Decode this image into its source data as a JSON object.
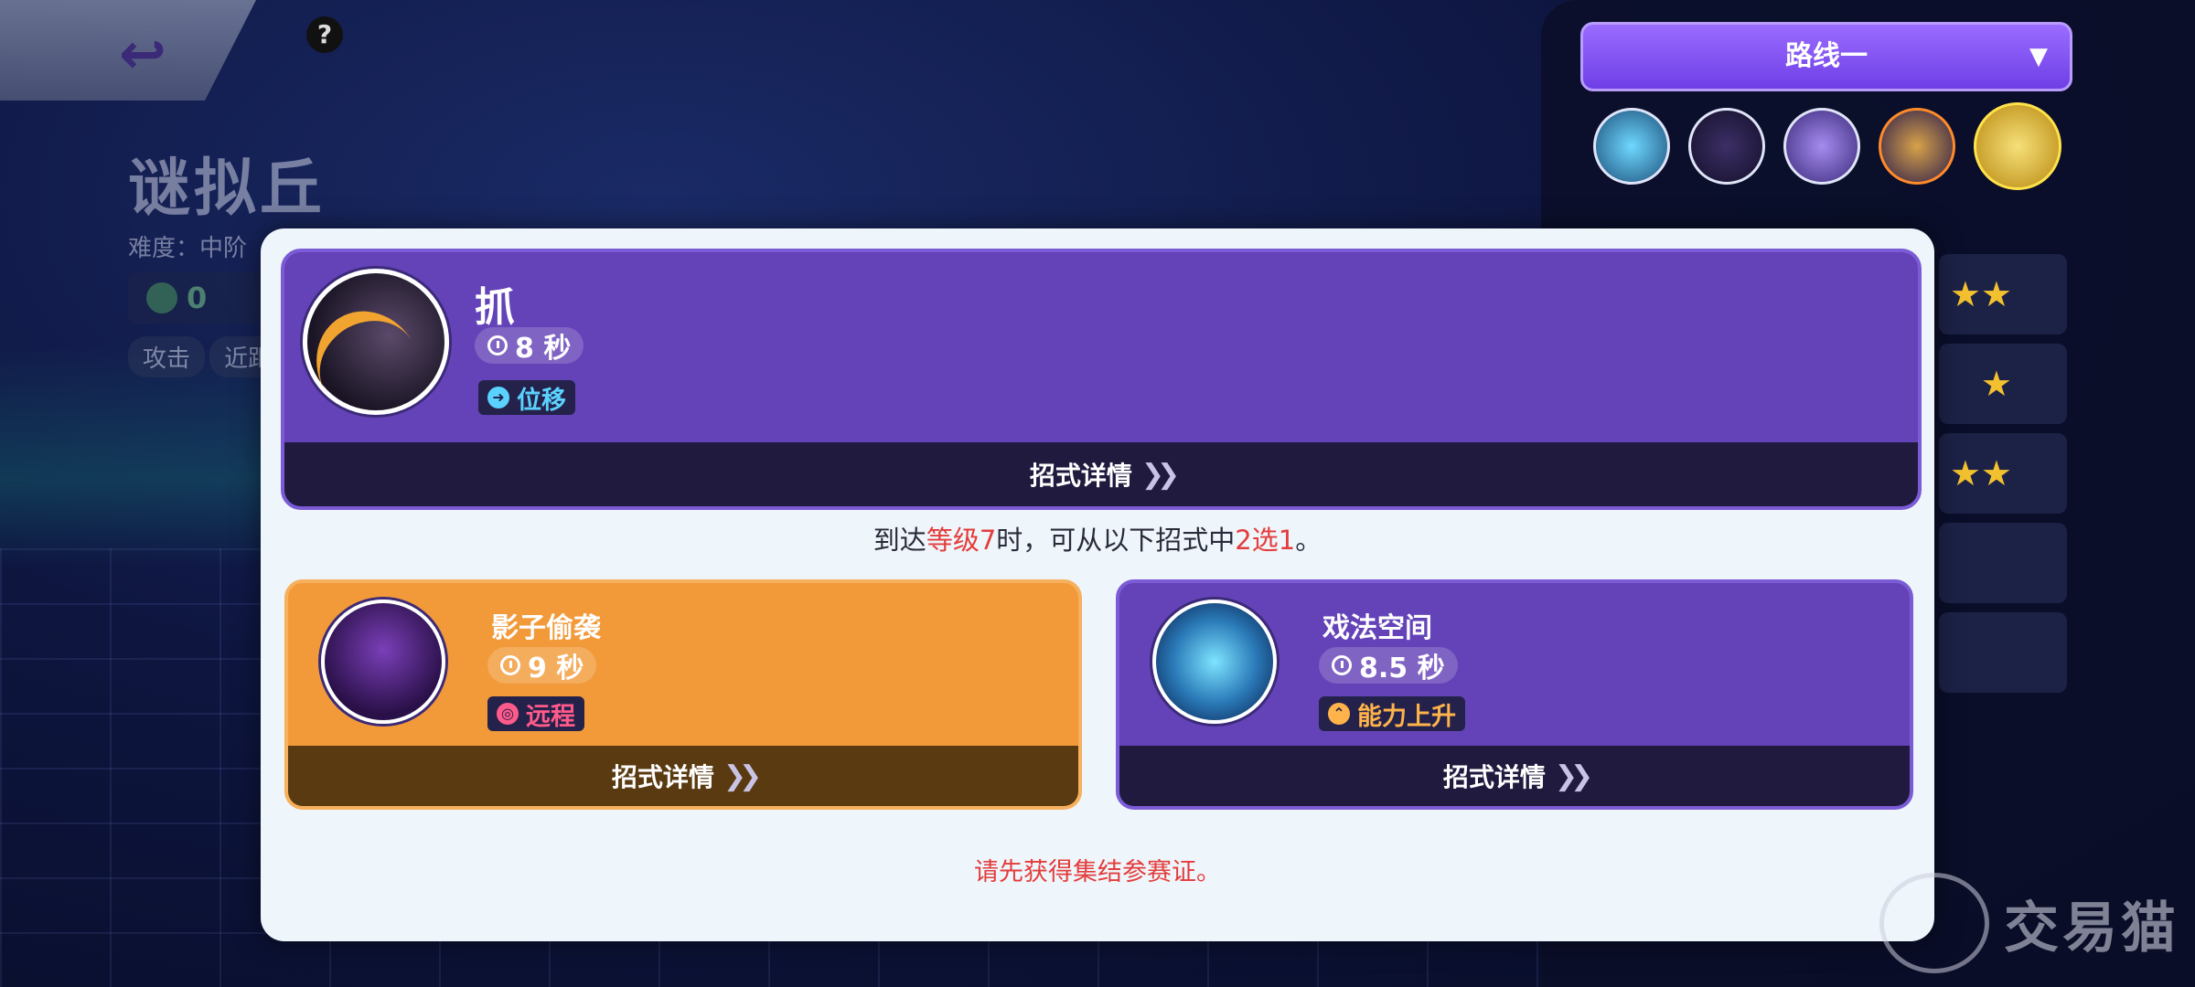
{
  "background": {
    "pokemon_name": "谜拟丘",
    "difficulty": "难度：中阶",
    "stat_value": "0",
    "role_tag": "攻击",
    "range_tag": "近距离"
  },
  "route": {
    "label": "路线一",
    "caret": "▼"
  },
  "route_skill_icons": [
    "gear-skill-icon",
    "shadow-sneak-icon",
    "play-rough-icon",
    "slash-icon",
    "unite-move-icon"
  ],
  "modal": {
    "main_skill": {
      "name": "抓",
      "cooldown": "8 秒",
      "type": "位移",
      "detail_label": "招式详情"
    },
    "notice": {
      "prefix": "到达",
      "highlight1": "等级7",
      "middle": "时，可从以下招式中",
      "highlight2": "2选1",
      "suffix": "。"
    },
    "options": [
      {
        "name": "影子偷袭",
        "cooldown": "9 秒",
        "type": "远程",
        "detail_label": "招式详情",
        "color": "#f29a3a"
      },
      {
        "name": "戏法空间",
        "cooldown": "8.5 秒",
        "type": "能力上升",
        "detail_label": "招式详情",
        "color": "#6443b8"
      }
    ],
    "warning": "请先获得集结参赛证。"
  },
  "watermark": "交易猫",
  "colors": {
    "accent_purple": "#6443b8",
    "accent_orange": "#f29a3a",
    "warning_red": "#e43c3c"
  }
}
